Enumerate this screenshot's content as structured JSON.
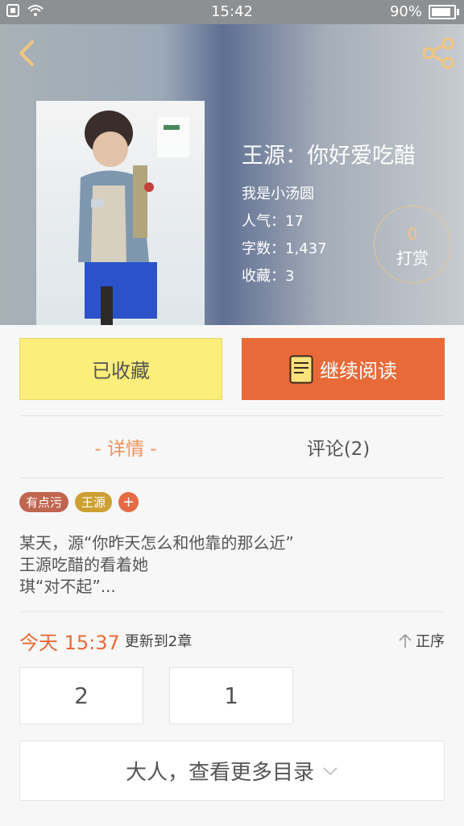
{
  "status_bar": {
    "time": "15:42",
    "battery": "90%",
    "battery_level": 0.9
  },
  "book": {
    "title": "王源：你好爱吃醋",
    "author": "我是小汤圆",
    "popularity": "人气：17",
    "word_count": "字数：1,437",
    "favorites": "收藏：3",
    "tip_count": "0",
    "tip_label": "打赏"
  },
  "actions": {
    "favorited_label": "已收藏",
    "continue_label": "继续阅读"
  },
  "tabs": [
    {
      "label": "- 详情 -"
    },
    {
      "label": "评论(2)"
    }
  ],
  "tags": [
    {
      "label": "有点污"
    },
    {
      "label": "王源"
    },
    {
      "label": "+"
    }
  ],
  "description": [
    "某天，源“你昨天怎么和他靠的那么近”",
    "王源吃醋的看着她",
    "琪“对不起”..."
  ],
  "update": {
    "time": "今天 15:37",
    "text": "更新到2章",
    "sort_label": "正序"
  },
  "chapters": [
    {
      "label": "2"
    },
    {
      "label": "1"
    }
  ],
  "more_label": "大人，查看更多目录",
  "colors": {
    "accent": "#e86a38",
    "favorite_bg": "#fbee7a",
    "tab_active": "#f0935e"
  }
}
